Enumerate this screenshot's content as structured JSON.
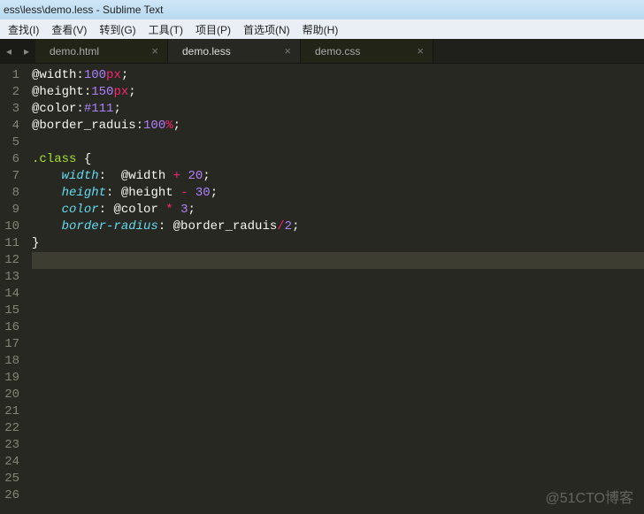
{
  "window": {
    "title": "ess\\less\\demo.less - Sublime Text"
  },
  "menubar": {
    "items": [
      {
        "label": "查找(I)"
      },
      {
        "label": "查看(V)"
      },
      {
        "label": "转到(G)"
      },
      {
        "label": "工具(T)"
      },
      {
        "label": "项目(P)"
      },
      {
        "label": "首选项(N)"
      },
      {
        "label": "帮助(H)"
      }
    ]
  },
  "tabs": [
    {
      "label": "demo.html",
      "active": false
    },
    {
      "label": "demo.less",
      "active": true
    },
    {
      "label": "demo.css",
      "active": false
    }
  ],
  "toolrow": {
    "left_glyph": "◂",
    "right_glyph": "▸",
    "close_glyph": "×"
  },
  "gutter": {
    "start": 1,
    "end": 26,
    "current": 12
  },
  "code": {
    "lines": [
      [
        {
          "t": "@width",
          "c": "c-var"
        },
        {
          "t": ":",
          "c": "c-punc"
        },
        {
          "t": "100",
          "c": "c-num"
        },
        {
          "t": "px",
          "c": "c-unit"
        },
        {
          "t": ";",
          "c": "c-punc"
        }
      ],
      [
        {
          "t": "@height",
          "c": "c-var"
        },
        {
          "t": ":",
          "c": "c-punc"
        },
        {
          "t": "150",
          "c": "c-num"
        },
        {
          "t": "px",
          "c": "c-unit"
        },
        {
          "t": ";",
          "c": "c-punc"
        }
      ],
      [
        {
          "t": "@color",
          "c": "c-var"
        },
        {
          "t": ":",
          "c": "c-punc"
        },
        {
          "t": "#111",
          "c": "c-num"
        },
        {
          "t": ";",
          "c": "c-punc"
        }
      ],
      [
        {
          "t": "@border_raduis",
          "c": "c-var"
        },
        {
          "t": ":",
          "c": "c-punc"
        },
        {
          "t": "100",
          "c": "c-num"
        },
        {
          "t": "%",
          "c": "c-unit"
        },
        {
          "t": ";",
          "c": "c-punc"
        }
      ],
      [],
      [
        {
          "t": ".class",
          "c": "c-sel"
        },
        {
          "t": " ",
          "c": "c-punc"
        },
        {
          "t": "{",
          "c": "c-brace"
        }
      ],
      [
        {
          "t": "    ",
          "c": "c-punc"
        },
        {
          "t": "width",
          "c": "c-prop"
        },
        {
          "t": ":  ",
          "c": "c-punc"
        },
        {
          "t": "@width",
          "c": "c-var"
        },
        {
          "t": " ",
          "c": "c-punc"
        },
        {
          "t": "+",
          "c": "c-op"
        },
        {
          "t": " ",
          "c": "c-punc"
        },
        {
          "t": "20",
          "c": "c-num"
        },
        {
          "t": ";",
          "c": "c-punc"
        }
      ],
      [
        {
          "t": "    ",
          "c": "c-punc"
        },
        {
          "t": "height",
          "c": "c-prop"
        },
        {
          "t": ": ",
          "c": "c-punc"
        },
        {
          "t": "@height",
          "c": "c-var"
        },
        {
          "t": " ",
          "c": "c-punc"
        },
        {
          "t": "-",
          "c": "c-op"
        },
        {
          "t": " ",
          "c": "c-punc"
        },
        {
          "t": "30",
          "c": "c-num"
        },
        {
          "t": ";",
          "c": "c-punc"
        }
      ],
      [
        {
          "t": "    ",
          "c": "c-punc"
        },
        {
          "t": "color",
          "c": "c-prop"
        },
        {
          "t": ": ",
          "c": "c-punc"
        },
        {
          "t": "@color",
          "c": "c-var"
        },
        {
          "t": " ",
          "c": "c-punc"
        },
        {
          "t": "*",
          "c": "c-op"
        },
        {
          "t": " ",
          "c": "c-punc"
        },
        {
          "t": "3",
          "c": "c-num"
        },
        {
          "t": ";",
          "c": "c-punc"
        }
      ],
      [
        {
          "t": "    ",
          "c": "c-punc"
        },
        {
          "t": "border-radius",
          "c": "c-prop"
        },
        {
          "t": ": ",
          "c": "c-punc"
        },
        {
          "t": "@border_raduis",
          "c": "c-var"
        },
        {
          "t": "/",
          "c": "c-op"
        },
        {
          "t": "2",
          "c": "c-num"
        },
        {
          "t": ";",
          "c": "c-punc"
        }
      ],
      [
        {
          "t": "}",
          "c": "c-brace"
        }
      ],
      [],
      [],
      [],
      [],
      [],
      [],
      [],
      [],
      [],
      [],
      [],
      [],
      [],
      [],
      []
    ]
  },
  "watermark": "@51CTO博客"
}
